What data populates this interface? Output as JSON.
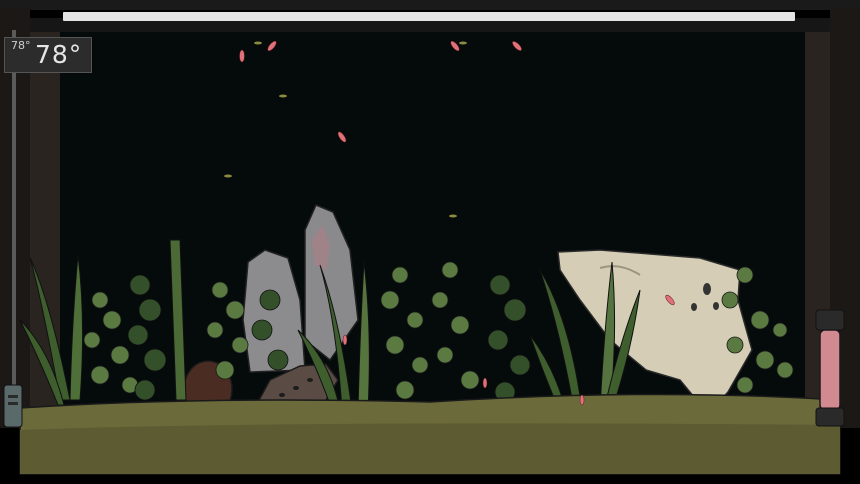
{
  "thermometer": {
    "small_reading": "78°",
    "large_reading": "78°"
  },
  "colors": {
    "water": "#050a0b",
    "frame": "#222222",
    "light_bar": "#e4e4e4",
    "substrate": "#6b6a3a",
    "plant_dark": "#3c5a2c",
    "plant_light": "#5f7d45",
    "rock_gray": "#8a8a8a",
    "driftwood": "#d5cdb6",
    "fish": "#e0707a",
    "heater": "#d08a90"
  },
  "icons": {
    "heater": "aquarium-heater-icon",
    "filter": "filter-intake-icon"
  }
}
